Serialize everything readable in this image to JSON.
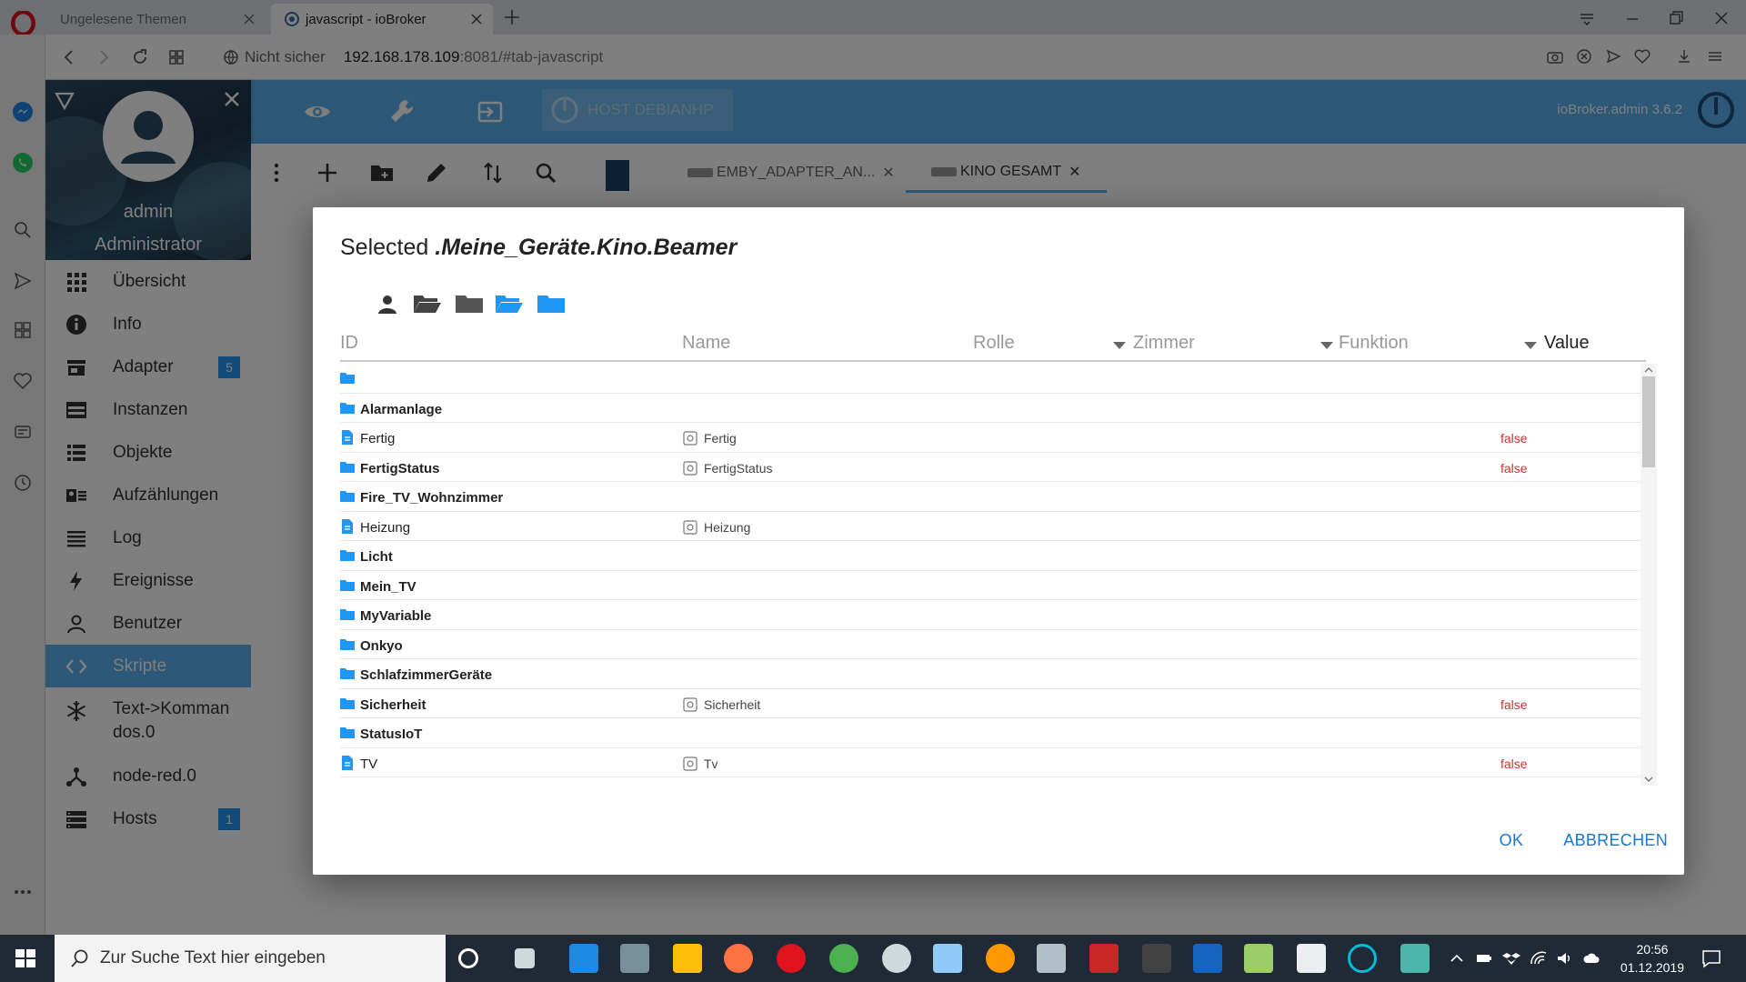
{
  "browser": {
    "tabs": [
      {
        "label": "Ungelesene Themen"
      },
      {
        "label": "javascript - ioBroker"
      }
    ],
    "security": "Nicht sicher",
    "url_host": "192.168.178.109",
    "url_rest": ":8081/#tab-javascript"
  },
  "header": {
    "host_label": "HOST DEBIANHP",
    "version": "ioBroker.admin 3.6.2"
  },
  "user": {
    "name": "admin",
    "role": "Administrator"
  },
  "nav": {
    "items": [
      {
        "label": "Übersicht",
        "icon": "grid-icon"
      },
      {
        "label": "Info",
        "icon": "info-icon"
      },
      {
        "label": "Adapter",
        "icon": "store-icon",
        "badge": "5"
      },
      {
        "label": "Instanzen",
        "icon": "instances-icon"
      },
      {
        "label": "Objekte",
        "icon": "list-icon"
      },
      {
        "label": "Aufzählungen",
        "icon": "enum-icon"
      },
      {
        "label": "Log",
        "icon": "log-icon"
      },
      {
        "label": "Ereignisse",
        "icon": "bolt-icon"
      },
      {
        "label": "Benutzer",
        "icon": "user-icon"
      },
      {
        "label": "Skripte",
        "icon": "code-icon",
        "active": true
      },
      {
        "label": "Text->Kommandos.0",
        "icon": "snowflake-icon"
      },
      {
        "label": "node-red.0",
        "icon": "nodes-icon"
      },
      {
        "label": "Hosts",
        "icon": "hosts-icon",
        "badge": "1"
      }
    ]
  },
  "editor_tabs": [
    {
      "label": "EMBY_ADAPTER_AN..."
    },
    {
      "label": "KINO GESAMT"
    }
  ],
  "dialog": {
    "title_prefix": "Selected",
    "title_path": ".Meine_Geräte.Kino.Beamer",
    "columns": {
      "id": "ID",
      "name": "Name",
      "role": "Rolle",
      "room": "Zimmer",
      "function": "Funktion",
      "value": "Value"
    },
    "rows": [
      {
        "id": "",
        "type": "folder",
        "name": "",
        "value": ""
      },
      {
        "id": "Alarmanlage",
        "type": "folder",
        "name": "",
        "value": ""
      },
      {
        "id": "Fertig",
        "type": "state",
        "name": "Fertig",
        "value": "false"
      },
      {
        "id": "FertigStatus",
        "type": "folder",
        "name": "FertigStatus",
        "value": "false"
      },
      {
        "id": "Fire_TV_Wohnzimmer",
        "type": "folder",
        "name": "",
        "value": ""
      },
      {
        "id": "Heizung",
        "type": "state",
        "name": "Heizung",
        "value": ""
      },
      {
        "id": "Licht",
        "type": "folder",
        "name": "",
        "value": ""
      },
      {
        "id": "Mein_TV",
        "type": "folder",
        "name": "",
        "value": ""
      },
      {
        "id": "MyVariable",
        "type": "folder",
        "name": "",
        "value": ""
      },
      {
        "id": "Onkyo",
        "type": "folder",
        "name": "",
        "value": ""
      },
      {
        "id": "SchlafzimmerGeräte",
        "type": "folder",
        "name": "",
        "value": ""
      },
      {
        "id": "Sicherheit",
        "type": "folder",
        "name": "Sicherheit",
        "value": "false"
      },
      {
        "id": "StatusIoT",
        "type": "folder",
        "name": "",
        "value": ""
      },
      {
        "id": "TV",
        "type": "state",
        "name": "Tv",
        "value": "false"
      }
    ],
    "ok_label": "OK",
    "cancel_label": "ABBRECHEN"
  },
  "taskbar": {
    "search_placeholder": "Zur Suche Text hier eingeben",
    "time": "20:56",
    "date": "01.12.2019"
  },
  "colors": {
    "accent": "#5ab0ee",
    "folder": "#2196f3",
    "value_false": "#d32f2f",
    "link": "#1976d2"
  }
}
